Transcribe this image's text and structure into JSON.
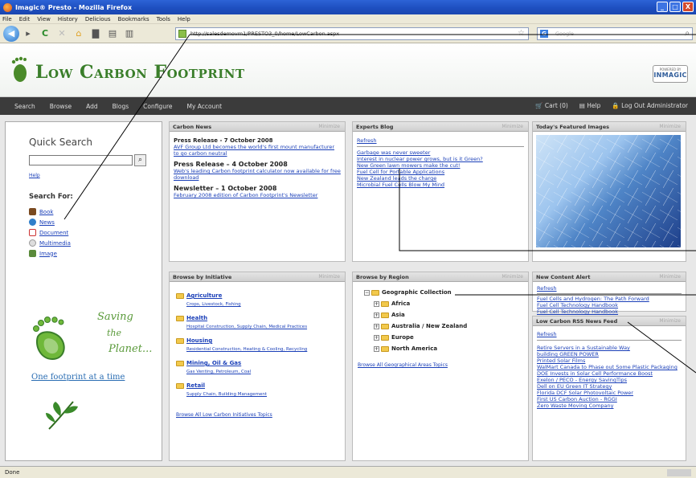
{
  "window": {
    "title": "Imagic® Presto - Mozilla Firefox",
    "minimize": "_",
    "maximize": "□",
    "close": "X"
  },
  "menu": [
    "File",
    "Edit",
    "View",
    "History",
    "Delicious",
    "Bookmarks",
    "Tools",
    "Help"
  ],
  "browser": {
    "url": "http://salesdemovm1/PRESTO3_0/home/LowCarbon.aspx",
    "search_placeholder": "Google"
  },
  "site": {
    "logo": "Low Carbon Footprint",
    "powered_by": "POWERED BY",
    "powered_brand": "INMAGIC"
  },
  "nav": {
    "left": [
      "Search",
      "Browse",
      "Add",
      "Blogs",
      "Configure",
      "My Account"
    ],
    "cart": "Cart (0)",
    "help": "Help",
    "logout": "Log Out Administrator"
  },
  "quick_search": {
    "title": "Quick Search",
    "help": "Help",
    "search_for": "Search For:",
    "items": [
      "Book",
      "News",
      "Document",
      "Multimedia",
      "Image"
    ]
  },
  "promo": {
    "saving_line1": "Saving",
    "saving_line2": "the",
    "saving_line3": "Planet...",
    "tagline": "One footprint at a time"
  },
  "carbon_news": {
    "title": "Carbon News",
    "minimize": "Minimize",
    "items": [
      {
        "head": "Press Release - 7 October 2008",
        "link": "AVF Group Ltd becomes the world's first mount manufacturer to go carbon neutral"
      },
      {
        "head": "Press Release – 4 October 2008",
        "link": "Web's leading Carbon footprint calculator now available for free download"
      },
      {
        "head": "Newsletter – 1 October 2008",
        "link": "February 2008 edition of Carbon Footprint's Newsletter"
      }
    ]
  },
  "experts_blog": {
    "title": "Experts Blog",
    "minimize": "Minimize",
    "refresh": "Refresh",
    "items": [
      "Garbage was never sweeter",
      "Interest in nuclear power grows, but is it Green?",
      "New Green lawn mowers make the cut!",
      "Fuel Cell for Portable Applications",
      "New Zealand leads the charge",
      "Microbial Fuel Cells Blow My Mind"
    ]
  },
  "featured": {
    "title": "Today's Featured Images",
    "minimize": "Minimize"
  },
  "browse_initiative": {
    "title": "Browse by Initiative",
    "minimize": "Minimize",
    "cats": [
      {
        "name": "Agriculture",
        "subs": "Crops,  Livestock,  Fishing"
      },
      {
        "name": "Health",
        "subs": "Hospital Construction,  Supply Chain,  Medical Practices"
      },
      {
        "name": "Housing",
        "subs": "Residential Construction,  Heating & Cooling,  Recycling"
      },
      {
        "name": "Mining, Oil & Gas",
        "subs": "Gas Venting,  Petroleum,  Coal"
      },
      {
        "name": "Retail",
        "subs": "Supply Chain,  Building Management"
      }
    ],
    "footer": "Browse All Low Carbon Initiatives Topics"
  },
  "browse_region": {
    "title": "Browse by Region",
    "minimize": "Minimize",
    "root": "Geographic Collection",
    "items": [
      "Africa",
      "Asia",
      "Australia / New Zealand",
      "Europe",
      "North America"
    ],
    "footer": "Browse All Geographical Areas Topics"
  },
  "new_content": {
    "title": "New Content Alert",
    "minimize": "Minimize",
    "refresh": "Refresh",
    "items": [
      "Fuel Cells and Hydrogen: The Path Forward",
      "Fuel Cell Technology Handbook",
      "Fuel Cell Technology Handbook"
    ]
  },
  "rss": {
    "title": "Low Carbon RSS News Feed",
    "minimize": "Minimize",
    "refresh": "Refresh",
    "items": [
      "Retire Servers in a Sustainable Way",
      "building GREEN POWER",
      "Printed Solar Films",
      "WalMart Canada to Phase out Some Plastic Packaging",
      "DOE Invests in Solar Cell Performance Boost",
      "Exelon / PECO - Energy SavingTips",
      "Dell on EU Green IT Strategy",
      "Florida DCF Solar Photovoltaic Power",
      "First US Carbon Auction - RGGI",
      "Zero Waste Moving Company"
    ]
  },
  "status": {
    "text": "Done"
  },
  "colors": {
    "brand_green": "#3a7e2a",
    "nav_dark": "#3b3b3b",
    "link": "#1a3fb8",
    "title_bar": "#1e4fc0"
  }
}
